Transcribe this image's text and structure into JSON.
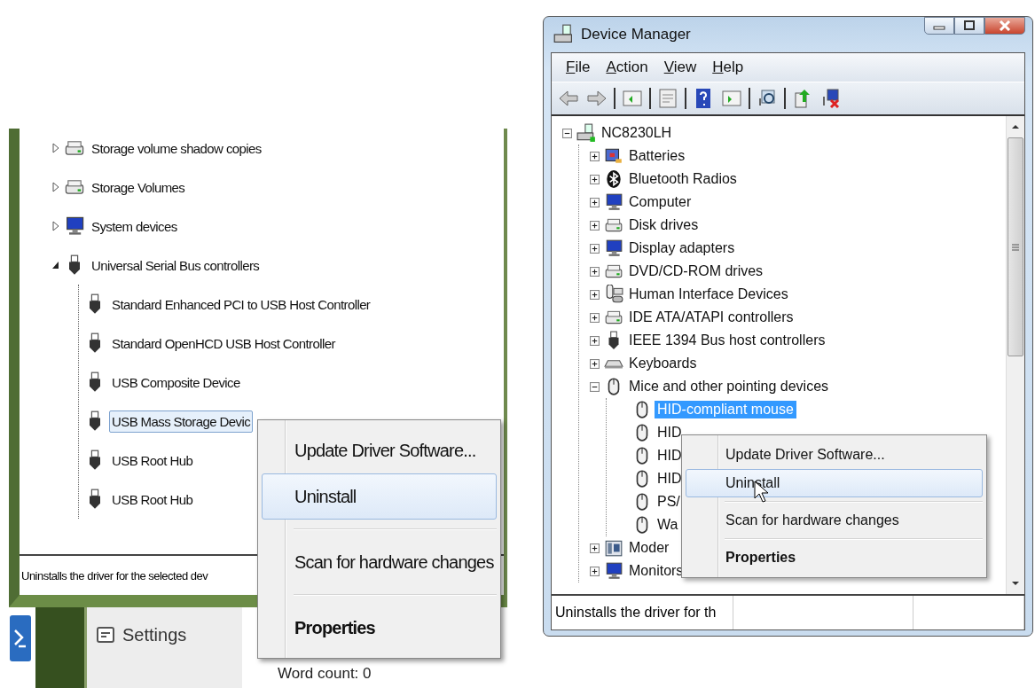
{
  "left_window": {
    "tree": [
      {
        "label": "Storage volume shadow copies",
        "kind": "drive",
        "expanded": false
      },
      {
        "label": "Storage Volumes",
        "kind": "drive",
        "expanded": false
      },
      {
        "label": "System devices",
        "kind": "monitor",
        "expanded": false
      },
      {
        "label": "Universal Serial Bus controllers",
        "kind": "usb",
        "expanded": true,
        "children": [
          {
            "label": "Standard Enhanced PCI to USB Host Controller",
            "kind": "usb",
            "selected": false
          },
          {
            "label": "Standard OpenHCD USB Host Controller",
            "kind": "usb",
            "selected": false
          },
          {
            "label": "USB Composite Device",
            "kind": "usb",
            "selected": false
          },
          {
            "label": "USB Mass Storage Devic",
            "kind": "usb",
            "selected": true
          },
          {
            "label": "USB Root Hub",
            "kind": "usb",
            "selected": false
          },
          {
            "label": "USB Root Hub",
            "kind": "usb",
            "selected": false
          }
        ]
      }
    ],
    "context_menu": [
      {
        "label": "Update Driver Software...",
        "highlighted": false,
        "default": false,
        "separator_before": false
      },
      {
        "label": "Uninstall",
        "highlighted": true,
        "default": false,
        "separator_before": false
      },
      {
        "label": "Scan for hardware changes",
        "highlighted": false,
        "default": false,
        "separator_before": true
      },
      {
        "label": "Properties",
        "highlighted": false,
        "default": true,
        "separator_before": true
      }
    ],
    "status_bar": "Uninstalls the driver for the selected dev"
  },
  "background_app": {
    "sidebar_item": "Settings",
    "status": "Word count: 0"
  },
  "right_window": {
    "title": "Device Manager",
    "menu": [
      "File",
      "Action",
      "View",
      "Help"
    ],
    "tree": {
      "label": "NC8230LH",
      "kind": "computer",
      "expanded": true,
      "children": [
        {
          "label": "Batteries",
          "kind": "battery",
          "expanded": false
        },
        {
          "label": "Bluetooth Radios",
          "kind": "bluetooth",
          "expanded": false
        },
        {
          "label": "Computer",
          "kind": "monitor",
          "expanded": false
        },
        {
          "label": "Disk drives",
          "kind": "drive",
          "expanded": false
        },
        {
          "label": "Display adapters",
          "kind": "monitor",
          "expanded": false
        },
        {
          "label": "DVD/CD-ROM drives",
          "kind": "drive",
          "expanded": false
        },
        {
          "label": "Human Interface Devices",
          "kind": "hid",
          "expanded": false
        },
        {
          "label": "IDE ATA/ATAPI controllers",
          "kind": "drive",
          "expanded": false
        },
        {
          "label": "IEEE 1394 Bus host controllers",
          "kind": "usb",
          "expanded": false
        },
        {
          "label": "Keyboards",
          "kind": "keyboard",
          "expanded": false
        },
        {
          "label": "Mice and other pointing devices",
          "kind": "mouse",
          "expanded": true,
          "children": [
            {
              "label": "HID-compliant mouse",
              "kind": "mouse",
              "selected": true
            },
            {
              "label": "HID",
              "kind": "mouse",
              "selected": false
            },
            {
              "label": "HID",
              "kind": "mouse",
              "selected": false
            },
            {
              "label": "HID",
              "kind": "mouse",
              "selected": false
            },
            {
              "label": "PS/",
              "kind": "mouse",
              "selected": false
            },
            {
              "label": "Wa",
              "kind": "mouse",
              "selected": false
            }
          ]
        },
        {
          "label": "Moder",
          "kind": "modem",
          "expanded": false
        },
        {
          "label": "Monitors",
          "kind": "monitor",
          "expanded": false
        }
      ]
    },
    "context_menu": [
      {
        "label": "Update Driver Software...",
        "highlighted": false,
        "default": false,
        "separator_before": false
      },
      {
        "label": "Uninstall",
        "highlighted": true,
        "default": false,
        "separator_before": false
      },
      {
        "label": "Scan for hardware changes",
        "highlighted": false,
        "default": false,
        "separator_before": true
      },
      {
        "label": "Properties",
        "highlighted": false,
        "default": true,
        "separator_before": true
      }
    ],
    "status_bar": [
      "Uninstalls the driver for th"
    ]
  }
}
